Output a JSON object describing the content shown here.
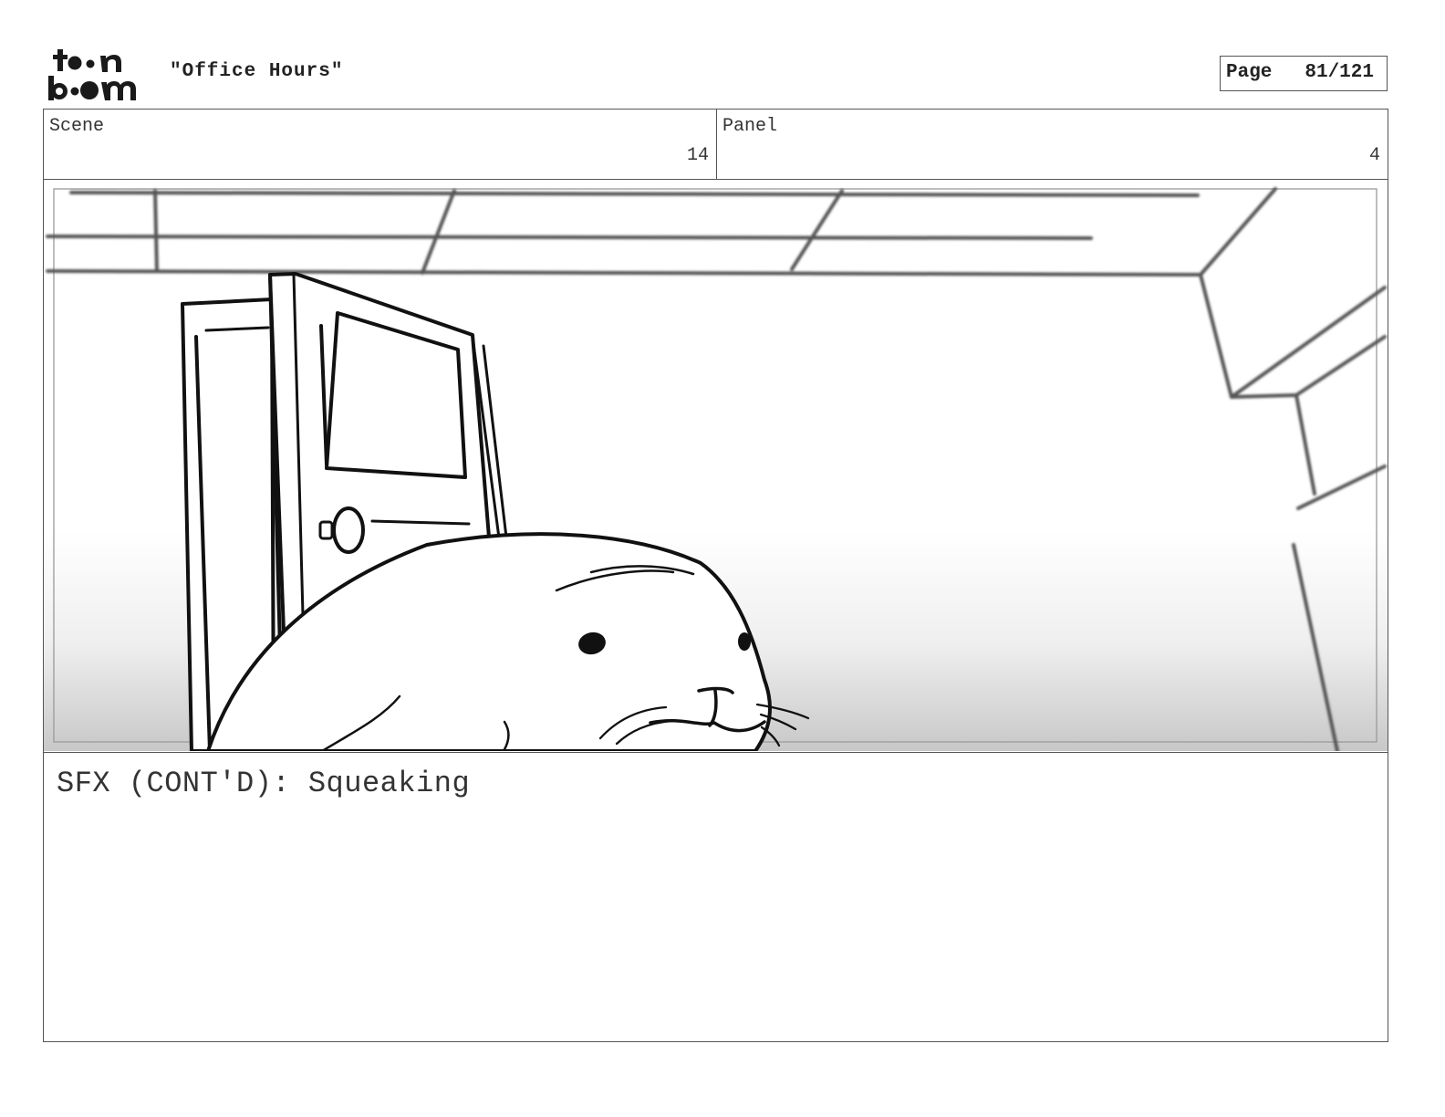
{
  "header": {
    "logo_text_top": "toon",
    "logo_text_bottom": "boom",
    "title": "\"Office Hours\"",
    "page_label": "Page",
    "page_number": "81/121"
  },
  "info": {
    "scene_label": "Scene",
    "scene_value": "14",
    "panel_label": "Panel",
    "panel_value": "4"
  },
  "dialogue": "SFX (CONT'D): Squeaking"
}
